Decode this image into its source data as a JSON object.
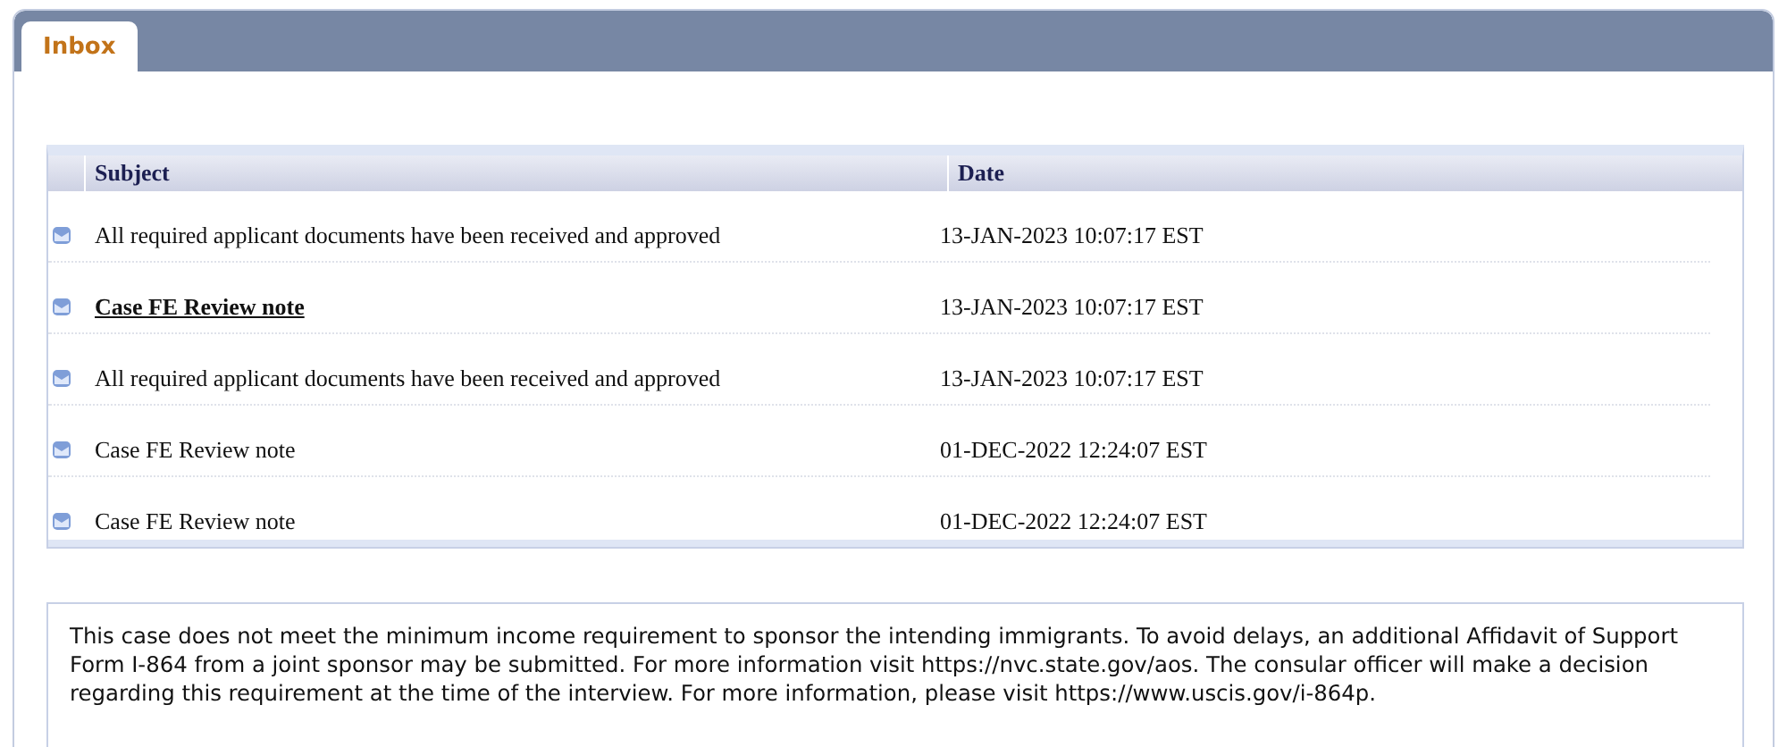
{
  "tabs": [
    {
      "label": "Inbox",
      "selected": true
    }
  ],
  "table": {
    "columns": [
      "Subject",
      "Date"
    ],
    "rows": [
      {
        "subject": "All required applicant documents have been received and approved",
        "date": "13-JAN-2023 10:07:17 EST",
        "selected": false
      },
      {
        "subject": "Case FE Review note",
        "date": "13-JAN-2023 10:07:17 EST",
        "selected": true
      },
      {
        "subject": "All required applicant documents have been received and approved",
        "date": "13-JAN-2023 10:07:17 EST",
        "selected": false
      },
      {
        "subject": "Case FE Review note",
        "date": "01-DEC-2022 12:24:07 EST",
        "selected": false
      },
      {
        "subject": "Case FE Review note",
        "date": "01-DEC-2022 12:24:07 EST",
        "selected": false
      }
    ]
  },
  "message": "This case does not meet the minimum income requirement to sponsor the intending immigrants. To avoid delays, an additional Affidavit of Support Form I-864 from a joint sponsor may be submitted. For more information visit https://nvc.state.gov/aos. The consular officer will make a decision regarding this requirement at the time of the interview. For more information, please visit https://www.uscis.gov/i-864p."
}
